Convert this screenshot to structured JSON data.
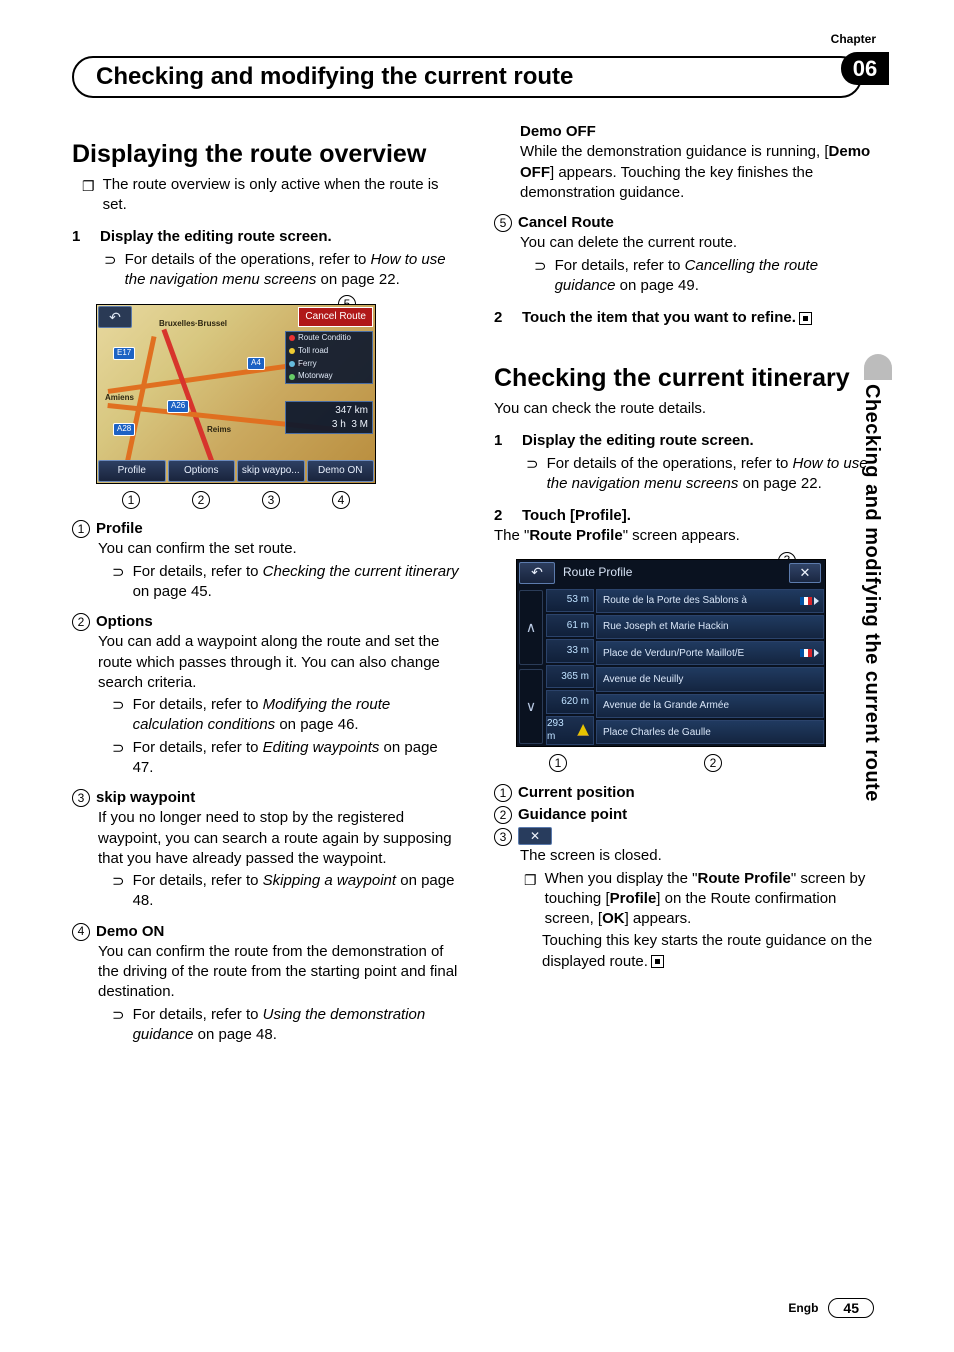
{
  "chapter": {
    "label": "Chapter",
    "number": "06"
  },
  "header_title": "Checking and modifying the current route",
  "side_tab": "Checking and modifying the current route",
  "footer": {
    "lang": "Engb",
    "page": "45"
  },
  "left": {
    "h_overview": "Displaying the route overview",
    "overview_note": "The route overview is only active when the route is set.",
    "step1_num": "1",
    "step1_title": "Display the editing route screen.",
    "step1_ref_lead": "For details of the operations, refer to ",
    "step1_ref_ital": "How to use the navigation menu screens",
    "step1_ref_tail": " on page 22.",
    "fig1": {
      "callout5": "5",
      "back": "↶",
      "cancel": "Cancel Route",
      "legend": {
        "route": "Route Conditio",
        "toll": "Toll road",
        "ferry": "Ferry",
        "motor": "Motorway"
      },
      "dist_km": "347 km",
      "dist_h": "3 h",
      "dist_m": "3 M",
      "btn_profile": "Profile",
      "btn_options": "Options",
      "btn_skip": "skip waypo...",
      "btn_demo": "Demo ON",
      "shield_e17": "E17",
      "shield_a28": "A28",
      "shield_a26": "A26",
      "shield_a4": "A4",
      "city_brux": "Bruxelles·Brussel",
      "city_amiens": "Amiens",
      "city_reims": "Reims",
      "n1": "1",
      "n2": "2",
      "n3": "3",
      "n4": "4"
    },
    "c1_title": "Profile",
    "c1_body": "You can confirm the set route.",
    "c1_ref_lead": "For details, refer to ",
    "c1_ref_ital": "Checking the current itinerary",
    "c1_ref_tail": " on page 45.",
    "c2_title": "Options",
    "c2_body": "You can add a waypoint along the route and set the route which passes through it. You can also change search criteria.",
    "c2_ref1_lead": "For details, refer to ",
    "c2_ref1_ital": "Modifying the route calculation conditions",
    "c2_ref1_tail": " on page 46.",
    "c2_ref2_lead": "For details, refer to ",
    "c2_ref2_ital": "Editing waypoints",
    "c2_ref2_tail": " on page 47.",
    "c3_title": "skip waypoint",
    "c3_body": "If you no longer need to stop by the registered waypoint, you can search a route again by supposing that you have already passed the waypoint.",
    "c3_ref_lead": "For details, refer to ",
    "c3_ref_ital": "Skipping a waypoint",
    "c3_ref_tail": " on page 48.",
    "c4_title": "Demo ON",
    "c4_body": "You can confirm the route from the demonstration of the driving of the route from the starting point and final destination.",
    "c4_ref_lead": "For details, refer to ",
    "c4_ref_ital": "Using the demonstration guidance",
    "c4_ref_tail": " on page 48."
  },
  "right": {
    "demo_off_title": "Demo OFF",
    "demo_off_body1": "While the demonstration guidance is running, [",
    "demo_off_bold": "Demo OFF",
    "demo_off_body2": "] appears. Touching the key finishes the demonstration guidance.",
    "c5_num": "5",
    "c5_title": "Cancel Route",
    "c5_body": "You can delete the current route.",
    "c5_ref_lead": "For details, refer to ",
    "c5_ref_ital": "Cancelling the route guidance",
    "c5_ref_tail": " on page 49.",
    "step2_num": "2",
    "step2_title": "Touch the item that you want to refine.",
    "h_itin": "Checking the current itinerary",
    "itin_lead": "You can check the route details.",
    "it_step1_num": "1",
    "it_step1_title": "Display the editing route screen.",
    "it_step1_ref_lead": "For details of the operations, refer to ",
    "it_step1_ref_ital": "How to use the navigation menu screens",
    "it_step1_ref_tail": " on page 22.",
    "it_step2_num": "2",
    "it_step2_title": "Touch [Profile].",
    "it_step2_body_a": "The \"",
    "it_step2_body_bold": "Route Profile",
    "it_step2_body_b": "\" screen appears.",
    "fig2": {
      "callout3": "3",
      "back": "↶",
      "title": "Route Profile",
      "close": "✕",
      "d1": "53 m",
      "d2": "61 m",
      "d3": "33 m",
      "d4": "365 m",
      "d5": "620 m",
      "d6": "293 m",
      "s1": "Route de la Porte des Sablons à",
      "s2": "Rue Joseph et Marie Hackin",
      "s3": "Place de Verdun/Porte Maillot/E",
      "s4": "Avenue de Neuilly",
      "s5": "Avenue de la Grande Armée",
      "s6": "Place Charles de Gaulle",
      "n1": "1",
      "n2": "2"
    },
    "l1_num": "1",
    "l1_title": "Current position",
    "l2_num": "2",
    "l2_title": "Guidance point",
    "l3_num": "3",
    "l3_close": "✕",
    "l3_body": "The screen is closed.",
    "l3_note_a": "When you display the \"",
    "l3_note_bold1": "Route Profile",
    "l3_note_b": "\" screen by touching [",
    "l3_note_bold2": "Profile",
    "l3_note_c": "] on the Route confirmation screen, [",
    "l3_note_bold3": "OK",
    "l3_note_d": "] appears.",
    "l3_note2": "Touching this key starts the route guidance on the displayed route."
  }
}
